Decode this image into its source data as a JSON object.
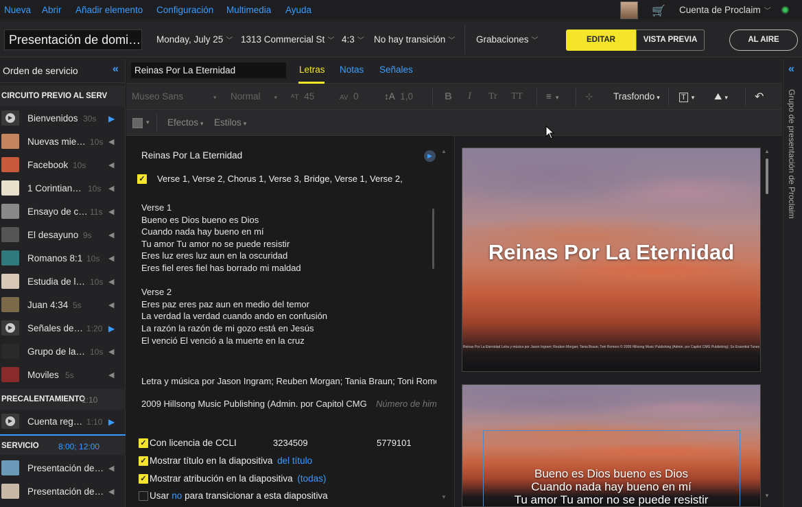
{
  "menu": [
    "Nueva",
    "Abrir",
    "Añadir elemento",
    "Configuración",
    "Multimedia",
    "Ayuda"
  ],
  "account": "Cuenta de Proclaim",
  "header": {
    "presentation_title": "Presentación de domi…",
    "date": "Monday, July 25",
    "location": "1313 Commercial St",
    "aspect": "4:3",
    "transition": "No hay transición",
    "recordings": "Grabaciones",
    "edit": "EDITAR",
    "preview": "VISTA PREVIA",
    "live": "AL AIRE"
  },
  "sidebar": {
    "title": "Orden de servicio",
    "sections": [
      {
        "label": "CIRCUITO PREVIO AL SERVICIO",
        "time": ""
      },
      {
        "label": "PRECALENTAMIENTO",
        "time": "1:10"
      },
      {
        "label": "SERVICIO",
        "time": "8:00; 12:00"
      }
    ],
    "items": [
      {
        "name": "Bienvenidos",
        "dur": "30s",
        "icon": "play",
        "thumb": "#3a3a3a"
      },
      {
        "name": "Nuevas mie…",
        "dur": "10s",
        "icon": "speaker",
        "thumb": "#c4855e"
      },
      {
        "name": "Facebook",
        "dur": "10s",
        "icon": "speaker",
        "thumb": "#c75a3a"
      },
      {
        "name": "1 Corintian…",
        "dur": "10s",
        "icon": "speaker",
        "thumb": "#e8e0cc"
      },
      {
        "name": "Ensayo de c…",
        "dur": "11s",
        "icon": "speaker",
        "thumb": "#8a8a8a"
      },
      {
        "name": "El desayuno",
        "dur": "9s",
        "icon": "speaker",
        "thumb": "#555555"
      },
      {
        "name": "Romanos 8:1",
        "dur": "10s",
        "icon": "speaker",
        "thumb": "#2f7a7a"
      },
      {
        "name": "Estudia de l…",
        "dur": "10s",
        "icon": "speaker",
        "thumb": "#d8c8b8"
      },
      {
        "name": "Juan 4:34",
        "dur": "5s",
        "icon": "speaker",
        "thumb": "#7a6a4a"
      },
      {
        "name": "Señales de…",
        "dur": "1:20",
        "icon": "play",
        "thumb": "#3a3a3a"
      },
      {
        "name": "Grupo de la…",
        "dur": "10s",
        "icon": "speaker",
        "thumb": "#2a2a2a"
      },
      {
        "name": "Moviles",
        "dur": "5s",
        "icon": "speaker",
        "thumb": "#8a2a2a"
      },
      {
        "name": "Cuenta reg…",
        "dur": "1:10",
        "icon": "play",
        "thumb": "#3a3a3a"
      },
      {
        "name": "Presentación de…",
        "dur": "",
        "icon": "speaker",
        "thumb": "#6a9ab8"
      },
      {
        "name": "Presentación de…",
        "dur": "",
        "icon": "speaker",
        "thumb": "#c8b8a8"
      }
    ]
  },
  "right_panel_label": "Grupo de presentación de Proclaim",
  "editor": {
    "item_title": "Reinas Por La Eternidad",
    "tabs": [
      "Letras",
      "Notas",
      "Señales"
    ],
    "toolbar": {
      "font": "Museo Sans",
      "weight": "Normal",
      "size": "45",
      "kerning": "0",
      "line_height": "1,0",
      "bold": "B",
      "italic": "I",
      "transform_a": "Tr",
      "transform_b": "TT",
      "background": "Trasfondo",
      "effects": "Efectos",
      "styles": "Estilos"
    },
    "song_title": "Reinas Por La Eternidad",
    "sequence": "Verse 1, Verse 2, Chorus 1, Verse 3, Bridge, Verse 1, Verse 2,",
    "lyrics": [
      "Verse 1",
      "Bueno es Dios bueno es Dios",
      "Cuando nada hay bueno en mí",
      "Tu amor Tu amor no se puede resistir",
      "Eres luz eres luz aun en la oscuridad",
      "Eres fiel eres fiel has borrado mi maldad",
      "",
      "Verse 2",
      "Eres paz eres paz aun en medio del temor",
      "La verdad la verdad cuando ando en confusión",
      "La razón la razón de mi gozo está en Jesús",
      "El venció El venció a la muerte en la cruz"
    ],
    "credits": "Letra y música por Jason Ingram; Reuben Morgan; Tania Braun; Toni Romero",
    "copyright": "2009 Hillsong Music Publishing (Admin. por Capitol CMG",
    "hymn_placeholder": "Número de himno",
    "ccli_label": "Con licencia de CCLI",
    "ccli_number_1": "3234509",
    "ccli_number_2": "5779101",
    "show_title_label": "Mostrar título en la diapositiva",
    "show_title_link": "del título",
    "show_attr_label": "Mostrar atribución en la diapositiva",
    "show_attr_link": "(todas)",
    "use_label": "Usar",
    "use_link": "no",
    "use_rest": "para transicionar a esta diapositiva"
  },
  "preview": {
    "slide1_title": "Reinas Por La Eternidad",
    "slide1_credit": "Reinas Por La Eternidad Letra y música por Jason Ingram; Reuben Morgan; Tania Braun; Toni Romero © 2009 Hillsong Music Publishing (Admin. por Capitol CMG Publishing); So Essential Tunes",
    "slide2_lines": [
      "Bueno es Dios bueno es Dios",
      "Cuando nada hay bueno en mí",
      "Tu amor Tu amor no se puede resistir"
    ]
  }
}
